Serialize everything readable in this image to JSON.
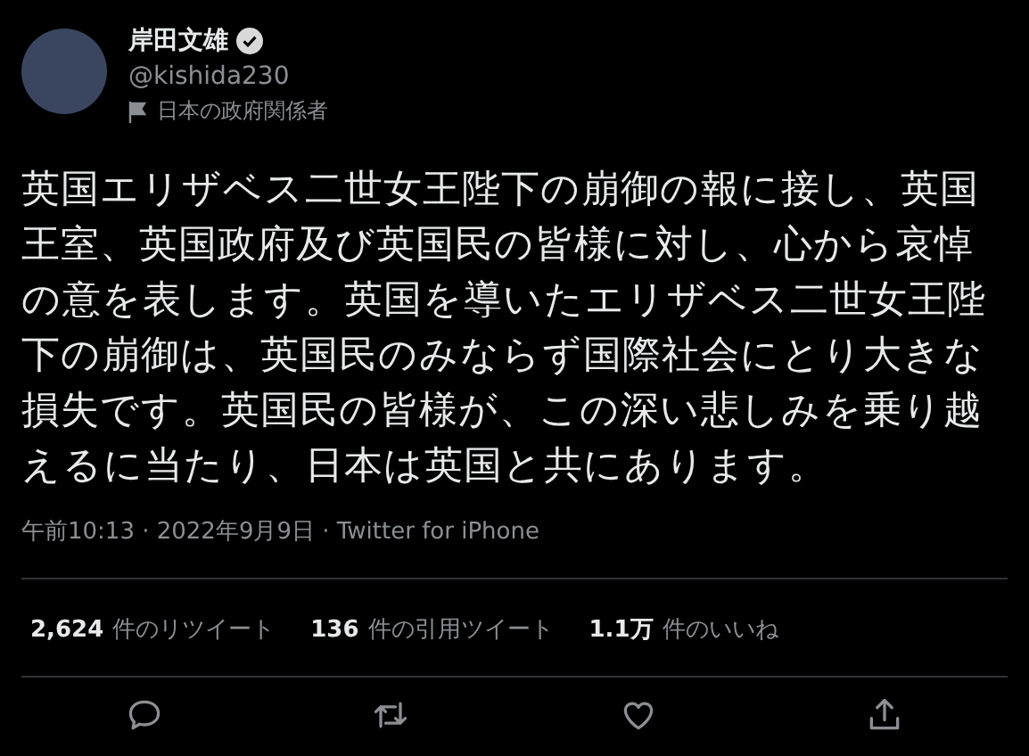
{
  "author": {
    "name": "岸田文雄",
    "verified": true,
    "handle": "@kishida230",
    "affiliation": "日本の政府関係者"
  },
  "tweet": {
    "text": "英国エリザベス二世女王陛下の崩御の報に接し、英国王室、英国政府及び英国民の皆様に対し、心から哀悼の意を表します。英国を導いたエリザベス二世女王陛下の崩御は、英国民のみならず国際社会にとり大きな損失です。英国民の皆様が、この深い悲しみを乗り越えるに当たり、日本は英国と共にあります。",
    "meta": "午前10:13 · 2022年9月9日 · Twitter for iPhone"
  },
  "stats": [
    {
      "count": "2,624",
      "label": "件のリツイート"
    },
    {
      "count": "136",
      "label": "件の引用ツイート"
    },
    {
      "count": "1.1万",
      "label": "件のいいね"
    }
  ]
}
